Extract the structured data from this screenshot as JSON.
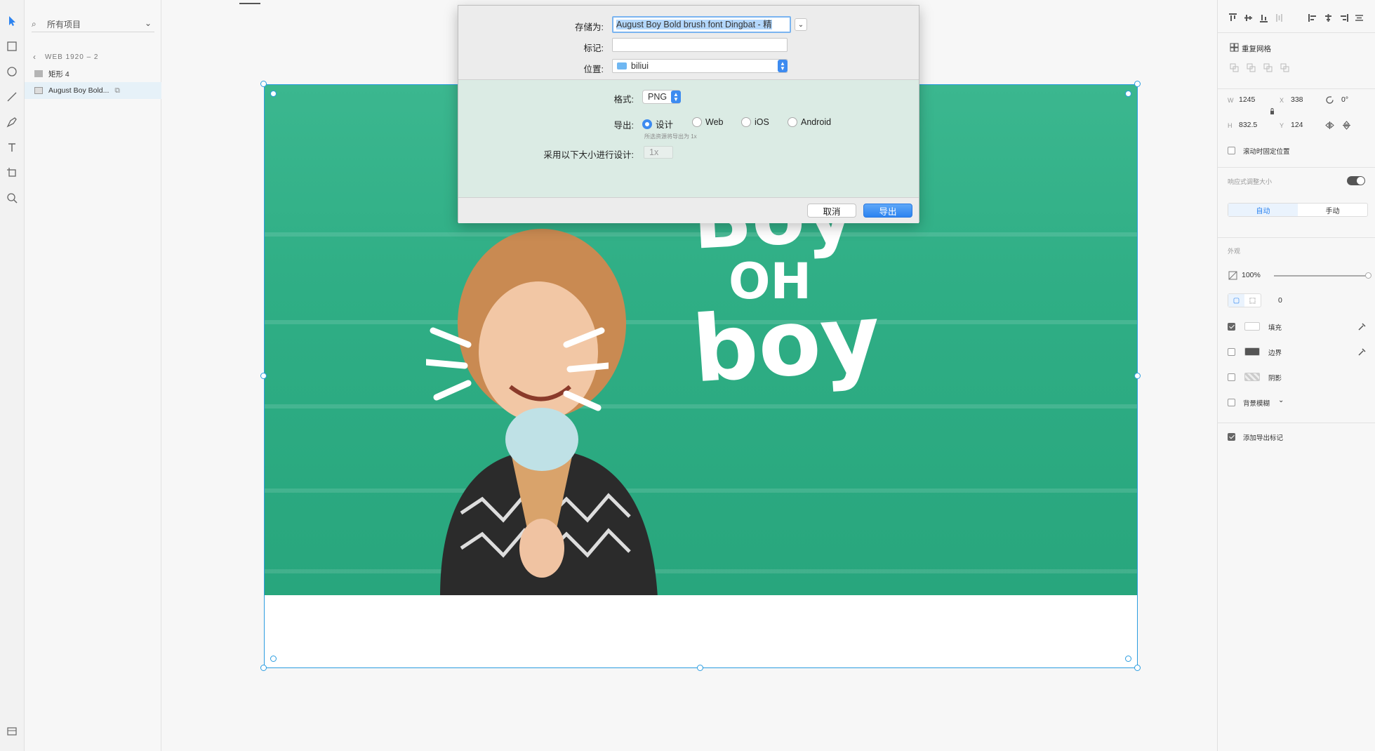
{
  "layers": {
    "search_placeholder": "所有项目",
    "breadcrumb": "WEB 1920 – 2",
    "items": [
      {
        "label": "矩形 4"
      },
      {
        "label": "August Boy Bold..."
      }
    ]
  },
  "artwork": {
    "line1": "Boy",
    "line2": "OH",
    "line3": "boy"
  },
  "dialog": {
    "save_as_label": "存储为:",
    "save_as_value": "August Boy Bold brush font Dingbat - 精",
    "tags_label": "标记:",
    "tags_value": "",
    "location_label": "位置:",
    "location_value": "biliui",
    "format_label": "格式:",
    "format_value": "PNG",
    "export_label": "导出:",
    "export_options": [
      {
        "label": "设计",
        "selected": true
      },
      {
        "label": "Web",
        "selected": false
      },
      {
        "label": "iOS",
        "selected": false
      },
      {
        "label": "Android",
        "selected": false
      }
    ],
    "export_hint": "所选资源将导出为 1x",
    "design_size_label": "采用以下大小进行设计:",
    "design_size_value": "1x",
    "cancel_label": "取消",
    "export_button_label": "导出",
    "accent_color": "#2c83f0"
  },
  "inspector": {
    "repeat_grid_label": "重复网格",
    "w_label": "W",
    "w_value": "1245",
    "x_label": "X",
    "x_value": "338",
    "rotation_value": "0°",
    "h_label": "H",
    "h_value": "832.5",
    "y_label": "Y",
    "y_value": "124",
    "fix_on_scroll_label": "滚动时固定位置",
    "responsive_label": "响应式调整大小",
    "responsive_on": true,
    "mode_auto": "自动",
    "mode_manual": "手动",
    "appearance_label": "外观",
    "opacity_value": "100%",
    "corner_value": "0",
    "fill_label": "填充",
    "fill_checked": true,
    "border_label": "边界",
    "border_checked": false,
    "shadow_label": "阴影",
    "shadow_checked": false,
    "bg_blur_label": "背景模糊",
    "bg_blur_checked": false,
    "export_mark_label": "添加导出标记",
    "export_mark_checked": true
  }
}
